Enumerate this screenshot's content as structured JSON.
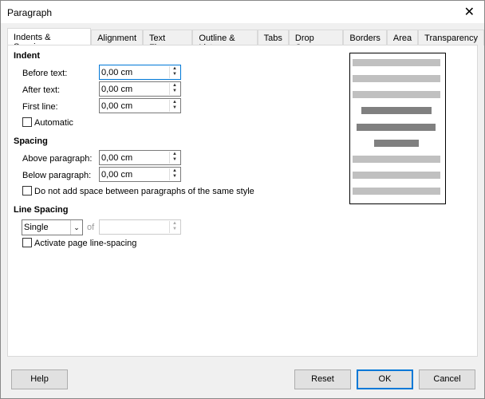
{
  "window": {
    "title": "Paragraph",
    "close_icon": "close-icon"
  },
  "tabs": [
    "Indents & Spacing",
    "Alignment",
    "Text Flow",
    "Outline & List",
    "Tabs",
    "Drop Caps",
    "Borders",
    "Area",
    "Transparency"
  ],
  "indent": {
    "heading": "Indent",
    "before_label": "Before text:",
    "before_value": "0,00 cm",
    "after_label": "After text:",
    "after_value": "0,00 cm",
    "first_label": "First line:",
    "first_value": "0,00 cm",
    "automatic_label": "Automatic",
    "automatic_checked": false
  },
  "spacing": {
    "heading": "Spacing",
    "above_label": "Above paragraph:",
    "above_value": "0,00 cm",
    "below_label": "Below paragraph:",
    "below_value": "0,00 cm",
    "no_space_label": "Do not add space between paragraphs of the same style",
    "no_space_checked": false
  },
  "line_spacing": {
    "heading": "Line Spacing",
    "selected": "Single",
    "of_label": "of",
    "of_value": "",
    "page_label": "Activate page line-spacing",
    "page_checked": false
  },
  "buttons": {
    "help": "Help",
    "reset": "Reset",
    "ok": "OK",
    "cancel": "Cancel"
  },
  "colors": {
    "accent": "#0078d7",
    "preview_light": "#c0c0c0",
    "preview_dark": "#808080"
  }
}
